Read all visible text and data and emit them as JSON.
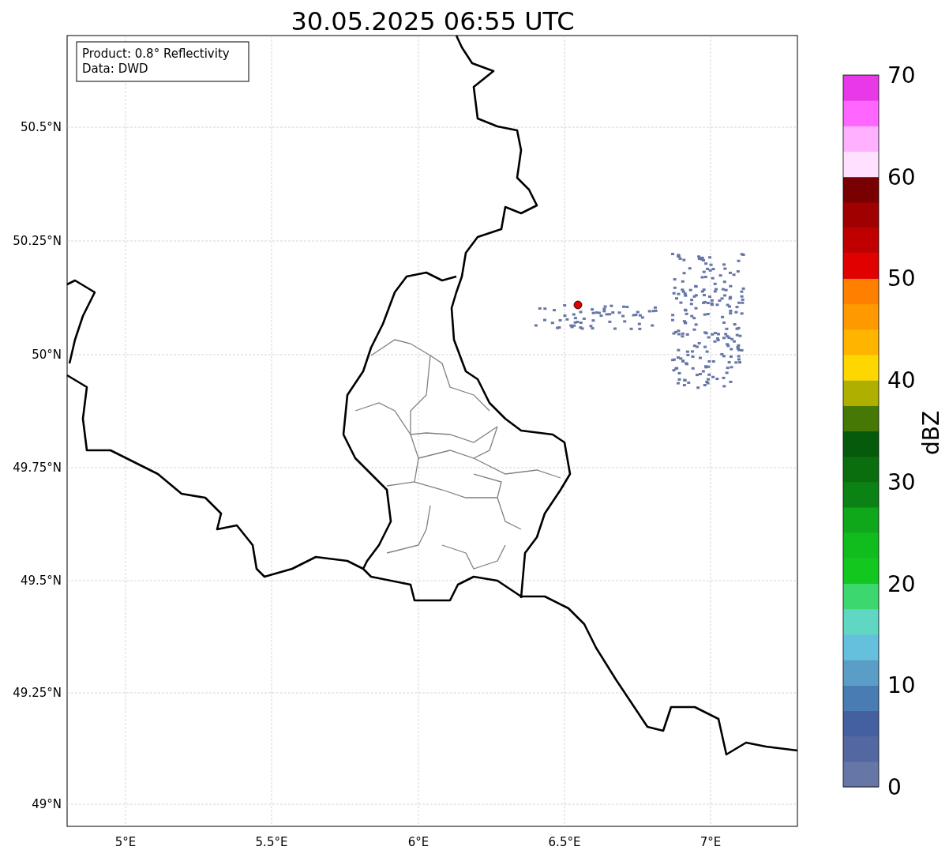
{
  "title": "30.05.2025 06:55 UTC",
  "info_box": [
    "Product: 0.8° Reflectivity",
    "Data: DWD"
  ],
  "x_ticks": [
    "5°E",
    "5.5°E",
    "6°E",
    "6.5°E",
    "7°E"
  ],
  "y_ticks": [
    "50.5°N",
    "50.25°N",
    "50°N",
    "49.75°N",
    "49.5°N",
    "49.25°N",
    "49°N"
  ],
  "colorbar": {
    "label": "dBZ",
    "tick_labels": [
      "70",
      "60",
      "50",
      "40",
      "30",
      "20",
      "10",
      "0"
    ],
    "segments": [
      {
        "color": "#6676a6"
      },
      {
        "color": "#5368a0"
      },
      {
        "color": "#4460a0"
      },
      {
        "color": "#4a7cb4"
      },
      {
        "color": "#5a9ec8"
      },
      {
        "color": "#64c0dc"
      },
      {
        "color": "#5fd7c3"
      },
      {
        "color": "#3cd76e"
      },
      {
        "color": "#12c81f"
      },
      {
        "color": "#10bc1e"
      },
      {
        "color": "#0fa81a"
      },
      {
        "color": "#0b8214"
      },
      {
        "color": "#0a6e0f"
      },
      {
        "color": "#065a0b"
      },
      {
        "color": "#467805"
      },
      {
        "color": "#afaf00"
      },
      {
        "color": "#ffd700"
      },
      {
        "color": "#ffb400"
      },
      {
        "color": "#ff9900"
      },
      {
        "color": "#ff7f00"
      },
      {
        "color": "#e00000"
      },
      {
        "color": "#c00000"
      },
      {
        "color": "#a00000"
      },
      {
        "color": "#780000"
      },
      {
        "color": "#ffe0ff"
      },
      {
        "color": "#ffb0ff"
      },
      {
        "color": "#ff66ff"
      },
      {
        "color": "#e838e8"
      }
    ]
  }
}
